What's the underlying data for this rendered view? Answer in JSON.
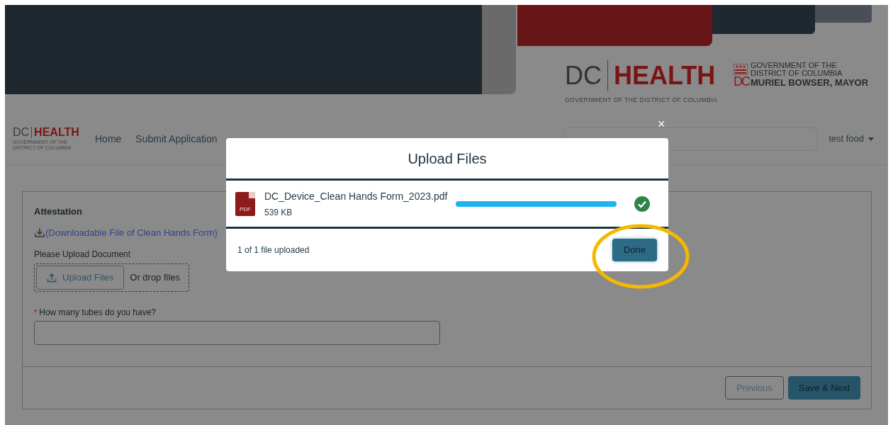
{
  "banner": {
    "logo": {
      "dc": "DC",
      "health": "HEALTH",
      "tagline": "GOVERNMENT OF THE DISTRICT OF COLUMBIA"
    },
    "gov_logo": {
      "mark": "DC",
      "lines": [
        "GOVERNMENT OF THE",
        "DISTRICT OF COLUMBIA"
      ],
      "mayor": "MURIEL BOWSER, MAYOR"
    }
  },
  "nav": {
    "logo": {
      "dc": "DC",
      "health": "HEALTH",
      "tagline": "GOVERNMENT OF THE DISTRICT OF COLUMBIA"
    },
    "items": [
      {
        "label": "Home"
      },
      {
        "label": "Submit Application"
      }
    ],
    "user_menu": "test food"
  },
  "form": {
    "section_title": "Attestation",
    "download_link": "(Downloadable File of Clean Hands Form)",
    "upload_label": "Please Upload Document",
    "upload_button": "Upload Files",
    "drop_text": "Or drop files",
    "question": {
      "required_mark": "*",
      "label": "How many tubes do you have?"
    },
    "buttons": {
      "previous": "Previous",
      "save_next": "Save & Next"
    }
  },
  "modal": {
    "close": "×",
    "title": "Upload Files",
    "files": [
      {
        "name": "DC_Device_Clean Hands Form_2023.pdf",
        "size": "539 KB",
        "file_type": "PDF",
        "level": 1,
        "done": true
      }
    ],
    "status": "1 of 1 file uploaded",
    "done_button": "Done"
  }
}
